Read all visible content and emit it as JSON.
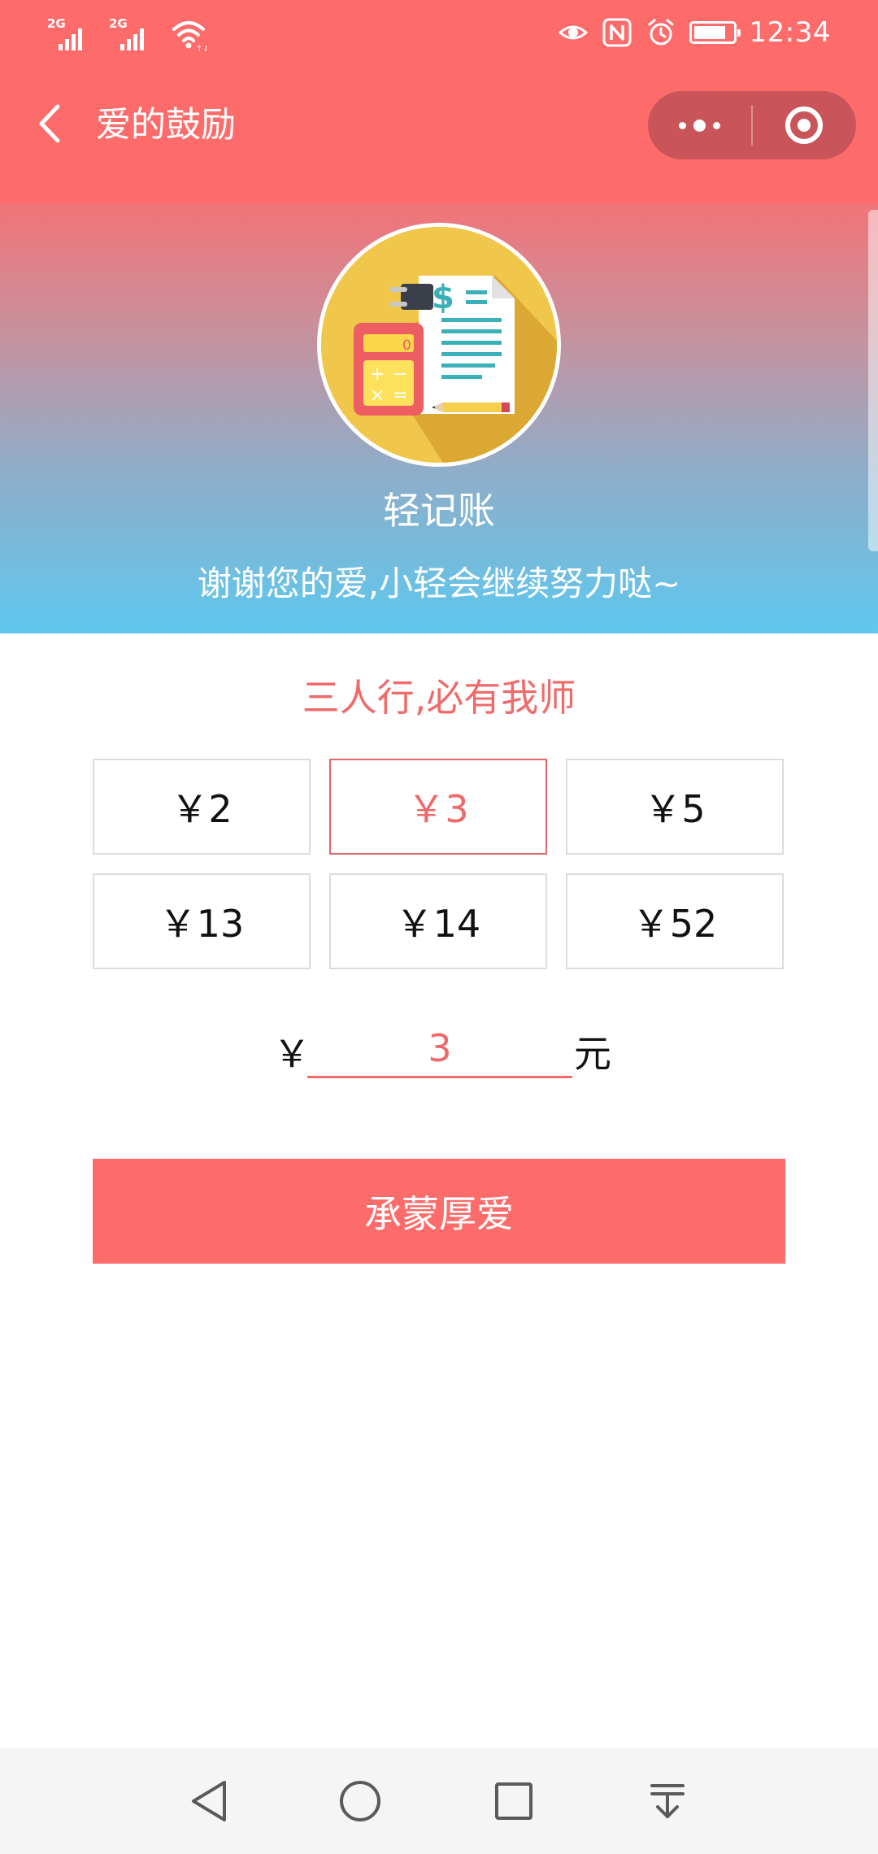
{
  "status_bar": {
    "signal_1_label": "2G",
    "signal_2_label": "2G",
    "icons": [
      "signal-icon",
      "signal-icon",
      "wifi-icon",
      "eye-icon",
      "nfc-icon",
      "alarm-icon",
      "battery-icon"
    ],
    "time": "12:34"
  },
  "nav": {
    "title": "爱的鼓励",
    "back_icon": "chevron-left-icon",
    "more_icon": "more-dots-icon",
    "close_icon": "target-icon"
  },
  "hero": {
    "app_name": "轻记账",
    "tagline": "谢谢您的爱,小轻会继续努力哒~",
    "gradient_top": "#f27478",
    "gradient_bottom": "#5ec8ee"
  },
  "donation": {
    "motto": "三人行,必有我师",
    "options": [
      "￥2",
      "￥3",
      "￥5",
      "￥13",
      "￥14",
      "￥52"
    ],
    "selected_index": 1,
    "currency_symbol": "￥",
    "custom_value": "3",
    "unit": "元",
    "submit_label": "承蒙厚爱"
  },
  "system_nav": {
    "icons": [
      "back-triangle-icon",
      "home-circle-icon",
      "recents-square-icon",
      "notification-pull-icon"
    ]
  },
  "colors": {
    "accent": "#fe6b6b",
    "accent_text": "#ef6a6a",
    "capsule": "#c9555a",
    "border": "#dcdcdc"
  }
}
